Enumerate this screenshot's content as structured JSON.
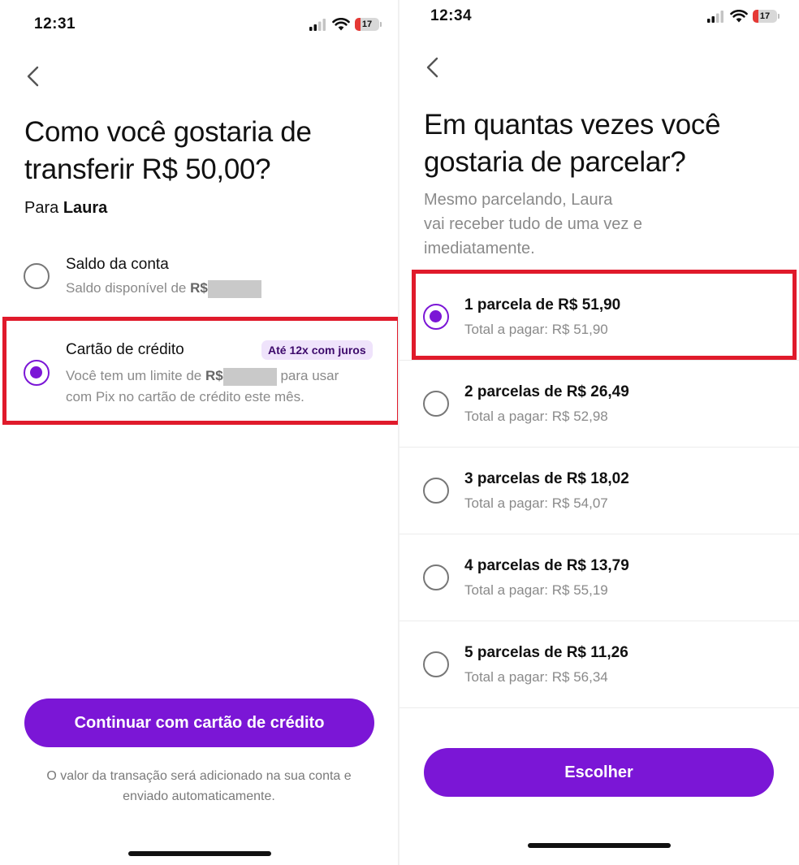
{
  "left": {
    "status_time": "12:31",
    "battery_level": "17",
    "title_line1": "Como você gostaria de",
    "title_line2": "transferir R$ 50,00?",
    "recipient_prefix": "Para",
    "recipient_name": "Laura",
    "options": [
      {
        "title": "Saldo da conta",
        "subtitle_prefix": "Saldo disponível de",
        "currency": "R$",
        "selected": false
      },
      {
        "title": "Cartão de crédito",
        "badge": "Até 12x com juros",
        "subtitle_prefix": "Você tem um limite de",
        "currency": "R$",
        "subtitle_suffix": "para usar",
        "subtitle_line2": "com Pix no cartão de crédito este mês.",
        "selected": true
      }
    ],
    "continue_button": "Continuar com cartão de crédito",
    "footnote_line1": "O valor da transação será adicionado na sua conta e",
    "footnote_line2": "enviado automaticamente."
  },
  "right": {
    "status_time": "12:34",
    "battery_level": "17",
    "title_line1": "Em quantas vezes você",
    "title_line2": "gostaria de parcelar?",
    "desc_line1": "Mesmo parcelando, Laura",
    "desc_line2": "vai receber tudo de uma vez e",
    "desc_line3": "imediatamente.",
    "installments": [
      {
        "title": "1 parcela de R$ 51,90",
        "total": "Total a pagar: R$ 51,90",
        "selected": true
      },
      {
        "title": "2 parcelas de R$ 26,49",
        "total": "Total a pagar: R$ 52,98",
        "selected": false
      },
      {
        "title": "3 parcelas de R$ 18,02",
        "total": "Total a pagar: R$ 54,07",
        "selected": false
      },
      {
        "title": "4 parcelas de R$ 13,79",
        "total": "Total a pagar: R$ 55,19",
        "selected": false
      },
      {
        "title": "5 parcelas de R$ 11,26",
        "total": "Total a pagar: R$ 56,34",
        "selected": false
      }
    ],
    "choose_button": "Escolher"
  },
  "icons": {
    "signal": "cellular-signal-icon",
    "wifi": "wifi-icon",
    "battery": "battery-icon",
    "back": "chevron-left-icon"
  },
  "colors": {
    "accent": "#7b16d6",
    "highlight": "#e01a2b",
    "badge_bg": "#efe3fb",
    "battery_low": "#e53935"
  }
}
